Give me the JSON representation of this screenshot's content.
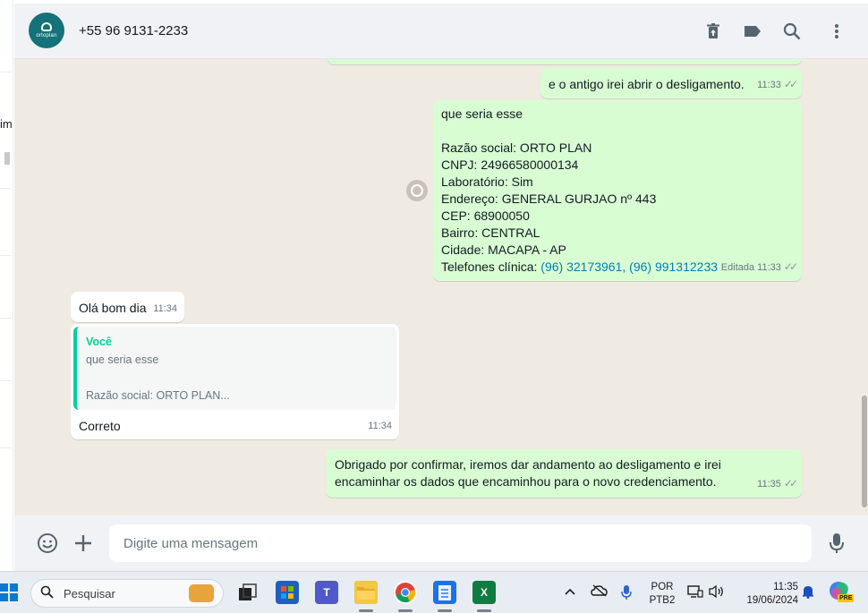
{
  "left_pane": {
    "fragment": "im"
  },
  "header": {
    "avatar_text": "ortoplan",
    "contact_name": "+55 96 9131-2233",
    "icons": [
      "delete-icon",
      "label-icon",
      "search-icon",
      "more-vert-icon"
    ]
  },
  "messages": [
    {
      "id": "m1",
      "direction": "out",
      "text": "e o antigo irei abrir o desligamento.",
      "time": "11:33"
    },
    {
      "id": "m2",
      "direction": "out",
      "lines": [
        "que seria esse",
        "",
        "Razão social: ORTO PLAN",
        "CNPJ: 24966580000134",
        "Laboratório: Sim",
        "Endereço: GENERAL GURJAO nº 443",
        "CEP: 68900050",
        "Bairro: CENTRAL",
        "Cidade: MACAPA - AP"
      ],
      "phones_label": "Telefones clínica: ",
      "phones": "(96) 32173961, (96) 991312233",
      "edited": "Editada",
      "time": "11:33"
    },
    {
      "id": "m3",
      "direction": "in",
      "text": "Olá bom dia",
      "time": "11:34"
    },
    {
      "id": "m4",
      "direction": "in",
      "quote_author": "Você",
      "quote_line1": "que seria esse",
      "quote_line2": "Razão social: ORTO PLAN...",
      "text": "Correto",
      "time": "11:34"
    },
    {
      "id": "m5",
      "direction": "out",
      "line1": "Obrigado por confirmar, iremos dar andamento ao desligamento e irei",
      "line2": "encaminhar os dados que encaminhou para o novo credenciamento.",
      "time": "11:35"
    }
  ],
  "composer": {
    "placeholder": "Digite uma mensagem"
  },
  "taskbar": {
    "search_label": "Pesquisar",
    "lang_top": "POR",
    "lang_bottom": "PTB2",
    "time": "11:35",
    "date": "19/06/2024",
    "copilot_badge": "PRE"
  }
}
